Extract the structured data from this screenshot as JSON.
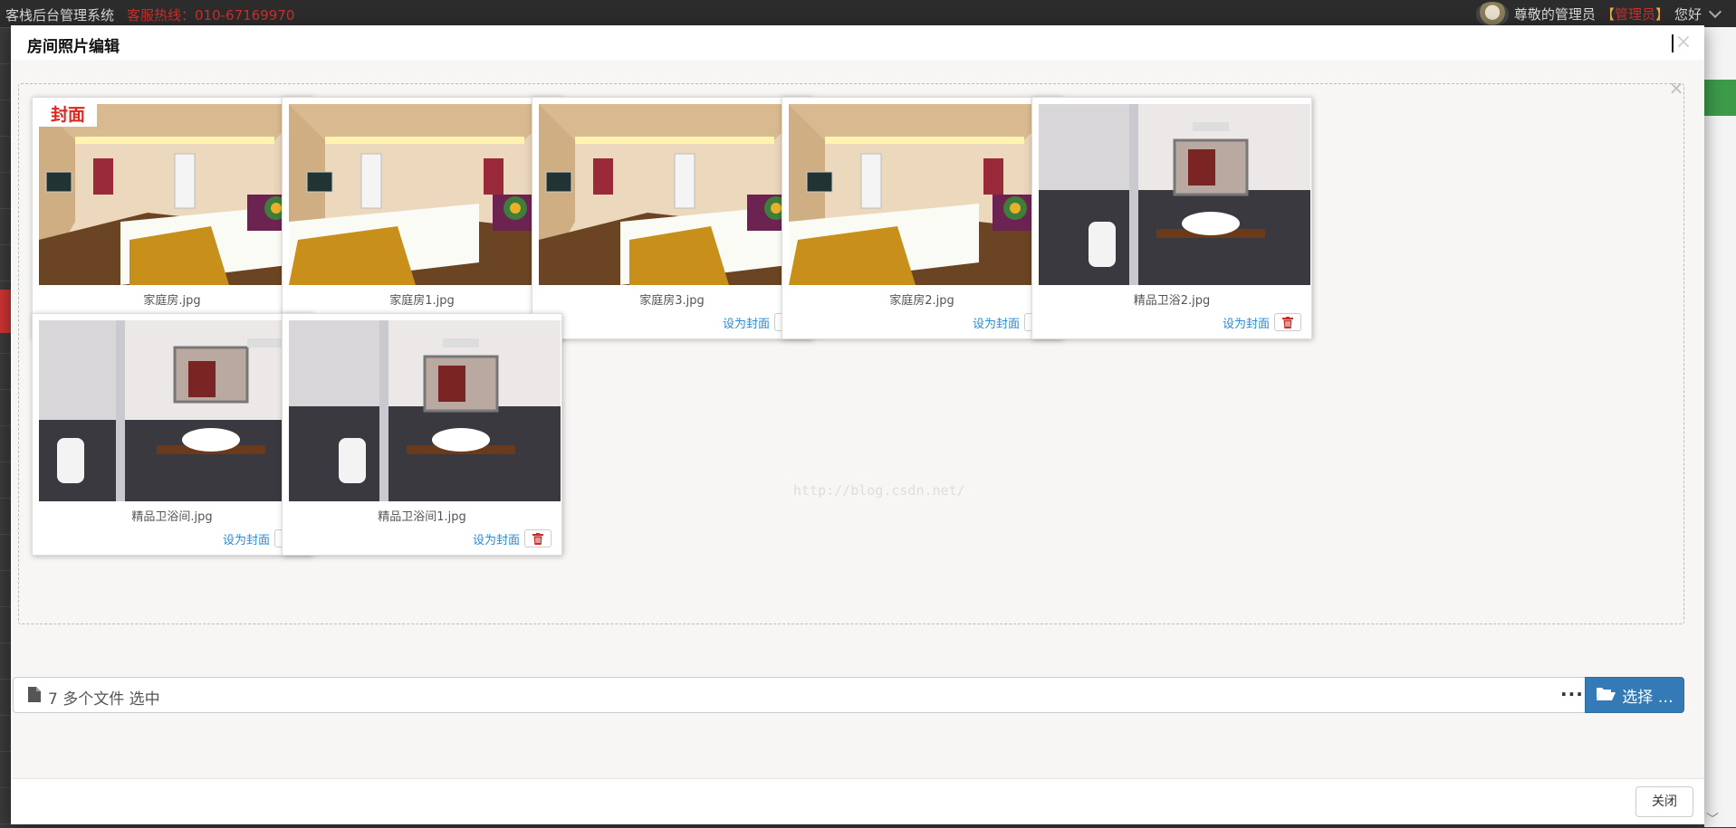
{
  "topbar": {
    "app_title": "客栈后台管理系统",
    "hotline": "客服热线：010-67169970",
    "greeting_prefix": "尊敬的管理员",
    "bracket_open": "【",
    "role": "管理员",
    "bracket_close": "】",
    "greeting_suffix": "您好"
  },
  "modal": {
    "title": "房间照片编辑",
    "close_glyph": "×",
    "preview_close_glyph": "×",
    "watermark": "http://blog.csdn.net/",
    "cover_badge": "封面",
    "set_cover_label": "设为封面",
    "photos": [
      {
        "filename": "家庭房.jpg",
        "scene": "bedroom",
        "is_cover": true
      },
      {
        "filename": "家庭房1.jpg",
        "scene": "bedroom",
        "is_cover": false
      },
      {
        "filename": "家庭房3.jpg",
        "scene": "bedroom",
        "is_cover": false
      },
      {
        "filename": "家庭房2.jpg",
        "scene": "bedroom",
        "is_cover": false
      },
      {
        "filename": "精品卫浴2.jpg",
        "scene": "bathroom",
        "is_cover": false
      },
      {
        "filename": "精品卫浴间.jpg",
        "scene": "bathroom",
        "is_cover": false
      },
      {
        "filename": "精品卫浴间1.jpg",
        "scene": "bathroom",
        "is_cover": false
      }
    ],
    "file_input": {
      "caption": "7 多个文件 选中",
      "more_glyph": "···",
      "browse_label": "选择 …"
    },
    "footer": {
      "close_label": "关闭"
    }
  },
  "colors": {
    "accent_blue": "#337ab7",
    "link_blue": "#2a8ad6",
    "cover_red": "#e0261d",
    "delete_red": "#d9534f",
    "hotline_red": "#c9302c"
  },
  "icons": {
    "file": "file-icon",
    "folder_open": "folder-open-icon",
    "trash": "trash-icon",
    "close": "close-icon",
    "more": "more-icon",
    "chevron": "chevron-down-icon"
  }
}
